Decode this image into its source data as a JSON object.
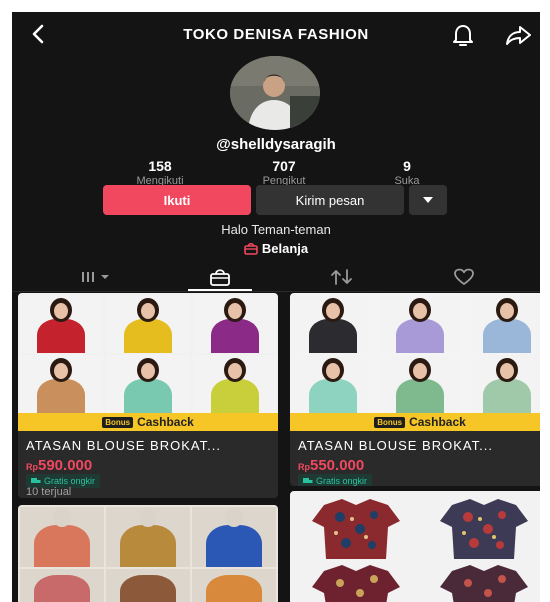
{
  "header": {
    "title": "TOKO DENISA FASHION",
    "back_icon": "back-arrow-icon",
    "bell_icon": "bell-icon",
    "share_icon": "share-icon"
  },
  "profile": {
    "username": "@shelldysaragih",
    "stats": [
      {
        "value": "158",
        "label": "Mengikuti"
      },
      {
        "value": "707",
        "label": "Pengikut"
      },
      {
        "value": "9",
        "label": "Suka"
      }
    ],
    "follow_label": "Ikuti",
    "message_label": "Kirim pesan",
    "bio": "Halo Teman-teman",
    "shop_label": "Belanja"
  },
  "tabs": [
    {
      "icon": "grid-icon",
      "active": false
    },
    {
      "icon": "shop-bag-icon",
      "active": true
    },
    {
      "icon": "repost-icon",
      "active": false
    },
    {
      "icon": "heart-icon",
      "active": false
    }
  ],
  "colors": {
    "accent": "#f1475f",
    "bonus": "#f5c625",
    "ship_green": "#27c2a0",
    "background": "#141414"
  },
  "products": [
    {
      "bonus_tag": "Bonus",
      "bonus_label": "Cashback",
      "name": "ATASAN BLOUSE  BROKAT...",
      "currency": "Rp",
      "price": "590.000",
      "shipping": "Gratis ongkir",
      "sold": "10 terjual"
    },
    {
      "bonus_tag": "Bonus",
      "bonus_label": "Cashback",
      "name": "ATASAN BLOUSE  BROKAT...",
      "currency": "Rp",
      "price": "550.000",
      "shipping": "Gratis ongkir"
    }
  ]
}
